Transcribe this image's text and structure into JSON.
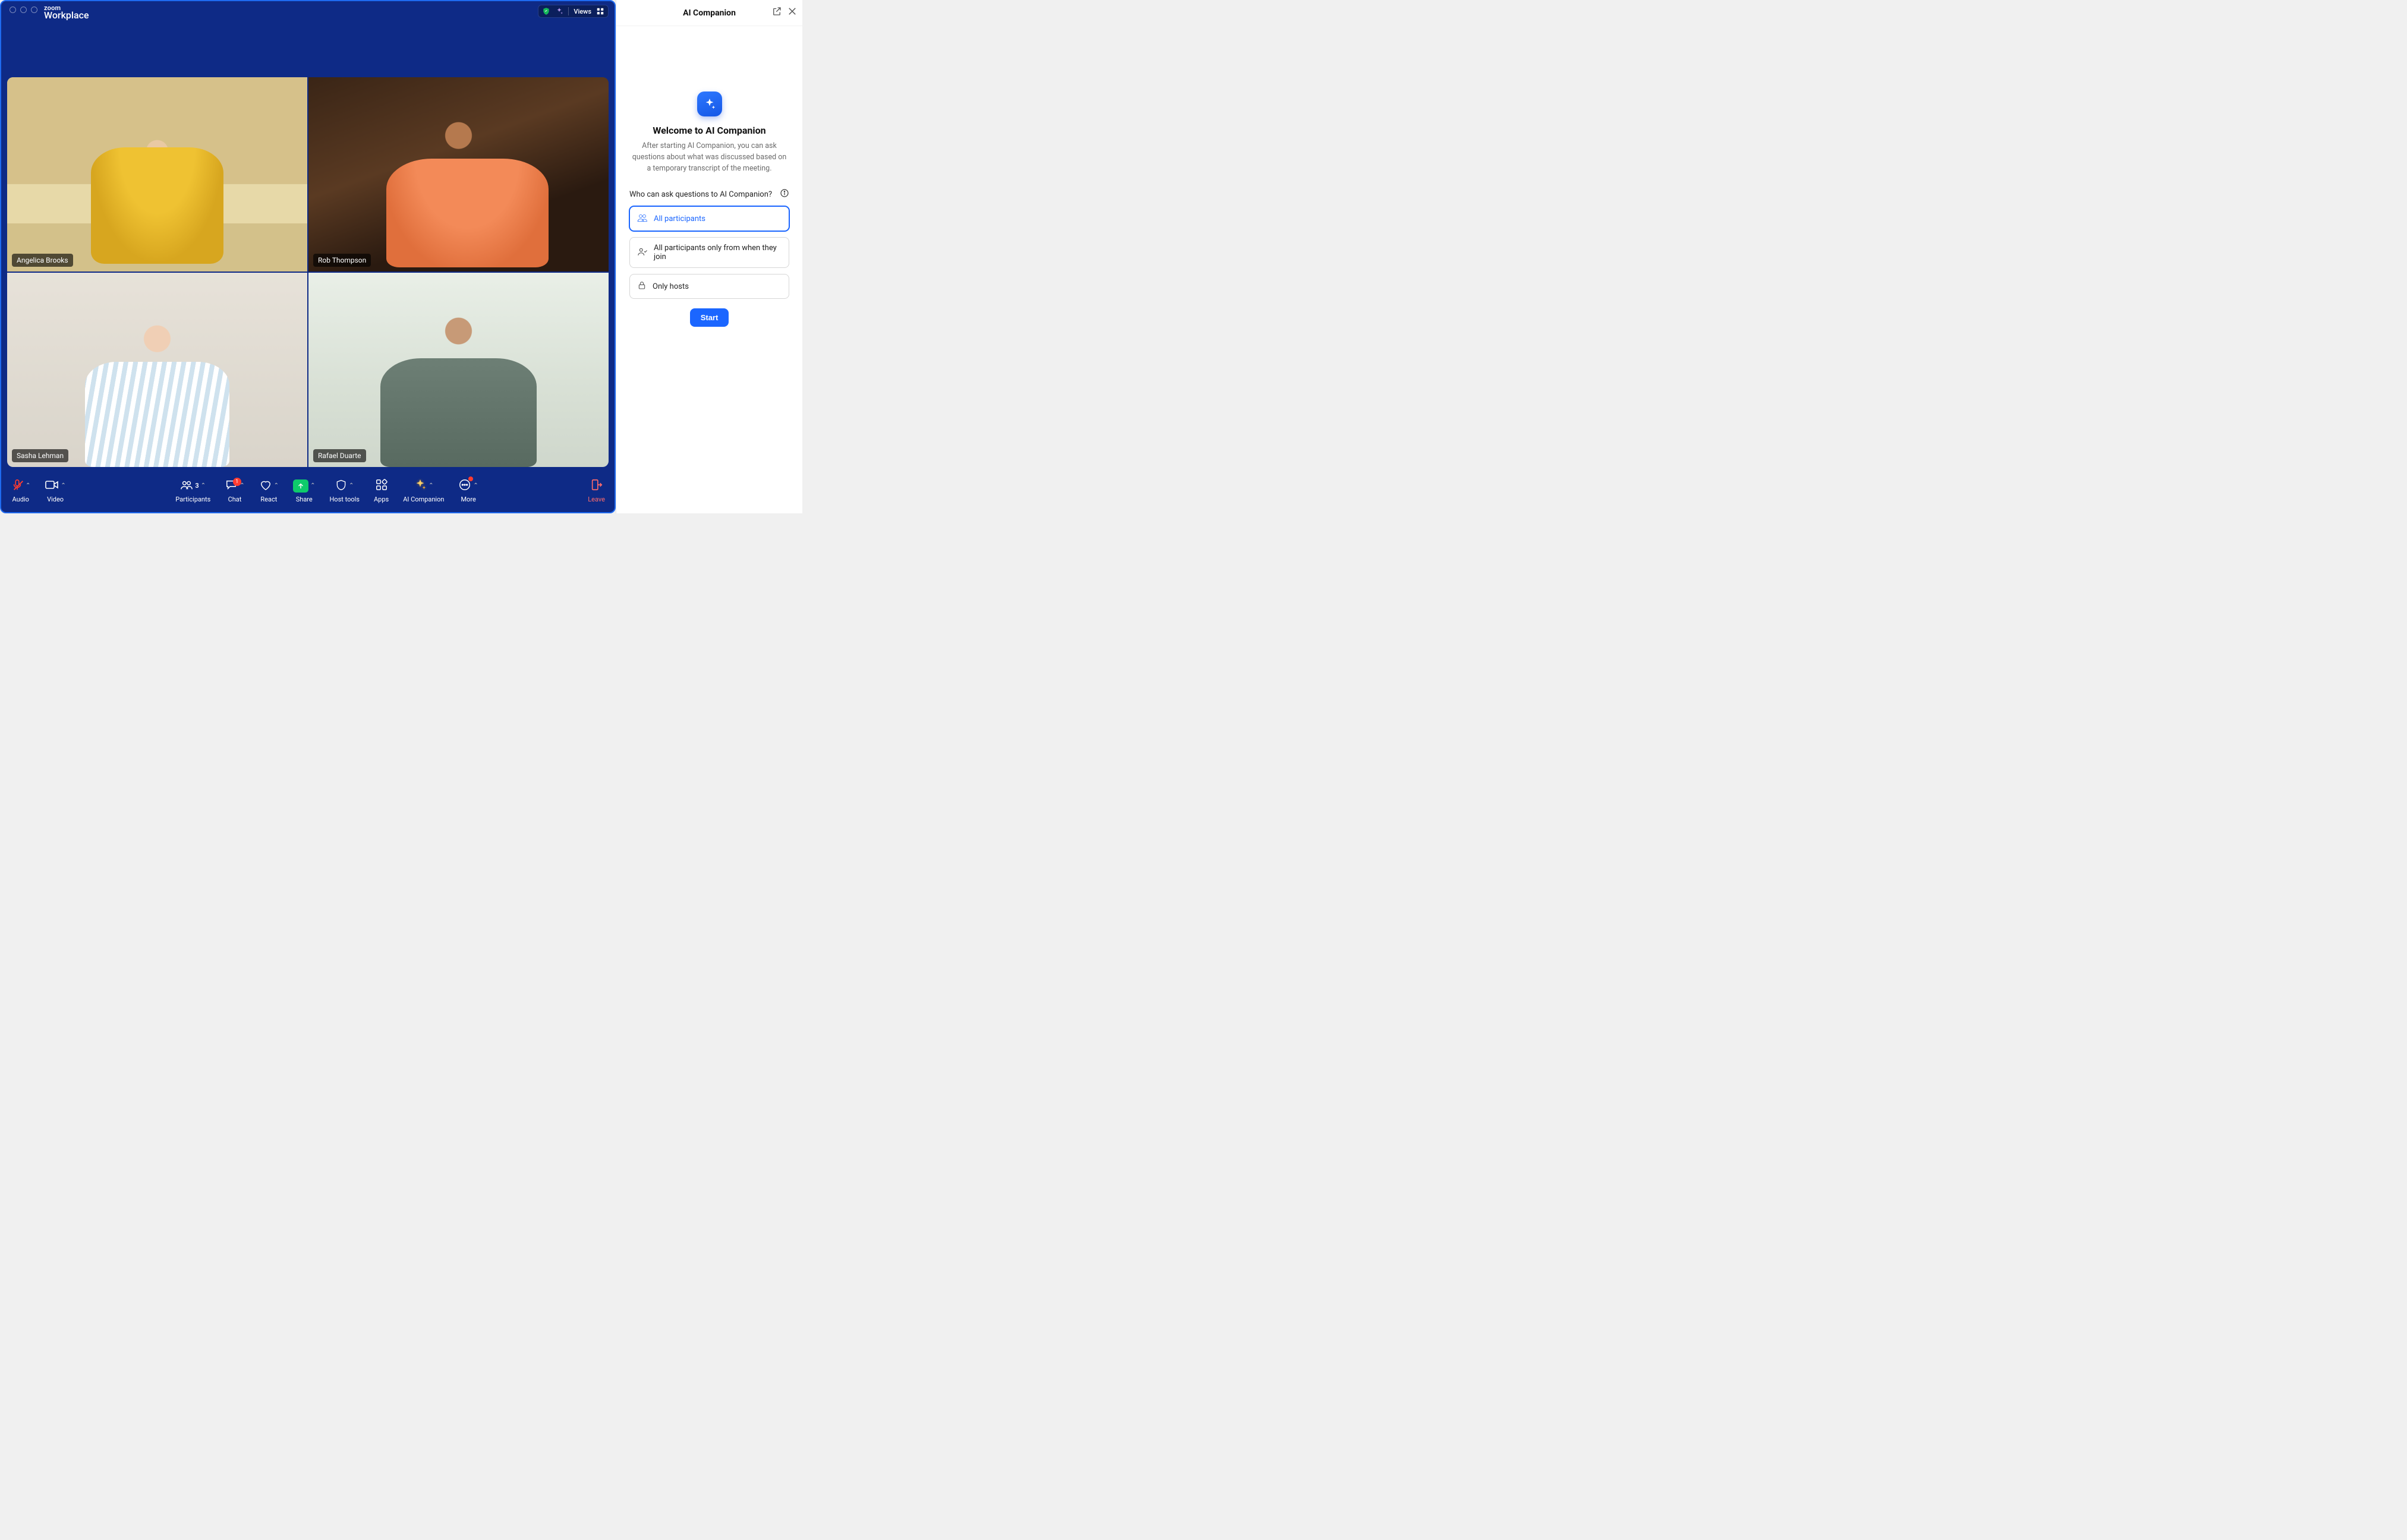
{
  "brand": {
    "top": "zoom",
    "bottom": "Workplace"
  },
  "topbar": {
    "views_label": "Views"
  },
  "participants": [
    {
      "name": "Angelica Brooks"
    },
    {
      "name": "Rob Thompson"
    },
    {
      "name": "Sasha Lehman"
    },
    {
      "name": "Rafael Duarte"
    }
  ],
  "toolbar": {
    "audio": "Audio",
    "video": "Video",
    "participants": "Participants",
    "participants_count": "3",
    "chat": "Chat",
    "chat_badge": "1",
    "react": "React",
    "share": "Share",
    "host_tools": "Host tools",
    "apps": "Apps",
    "ai_companion": "AI Companion",
    "more": "More",
    "leave": "Leave"
  },
  "panel": {
    "title": "AI Companion",
    "welcome": "Welcome to AI Companion",
    "description": "After starting AI Companion, you can ask questions about what was discussed based on a temporary transcript of the meeting.",
    "question": "Who can ask questions to AI Companion?",
    "choices": [
      "All participants",
      "All participants only from when they join",
      "Only hosts"
    ],
    "start": "Start"
  }
}
